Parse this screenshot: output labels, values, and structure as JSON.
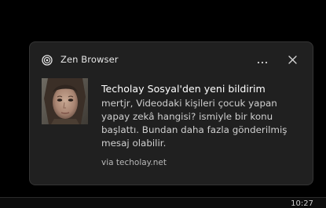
{
  "notification": {
    "app_name": "Zen Browser",
    "app_icon": "zen-browser-icon",
    "more_icon": "more-horizontal-icon",
    "close_icon": "close-icon",
    "thumbnail": "profile-thumbnail",
    "title": "Techolay Sosyal'den yeni bildirim",
    "body": "mertjr, Videodaki kişileri çocuk yapan yapay zekâ hangisi? ismiyle bir konu başlattı. Bundan daha fazla gönderilmiş mesaj olabilir.",
    "attribution": "via techolay.net"
  },
  "taskbar": {
    "clock_fragment": "10:27"
  },
  "colors": {
    "background": "#000000",
    "toast_bg": "#202020",
    "toast_border": "#353535",
    "title_text": "#ffffff",
    "body_text": "#d0d0d0"
  }
}
